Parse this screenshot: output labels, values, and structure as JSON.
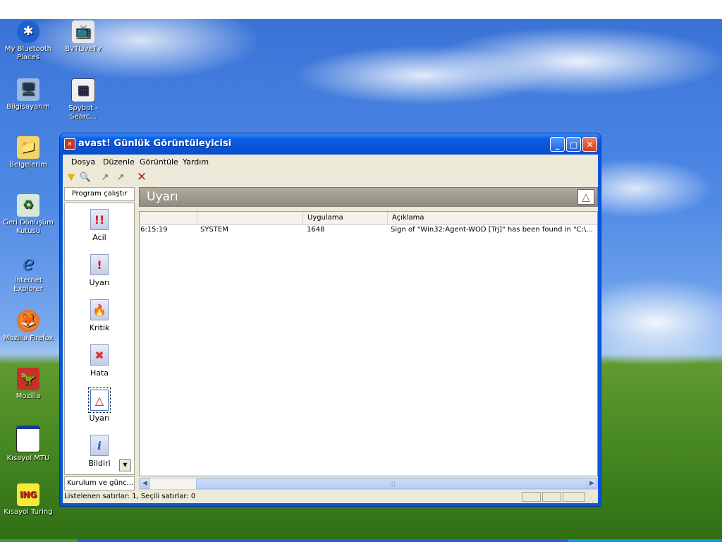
{
  "desktop": {
    "icons": [
      {
        "label": "My Bluetooth Places",
        "icon": "bluetooth-icon"
      },
      {
        "label": "BvTLiveTv",
        "icon": "tv-icon"
      },
      {
        "label": "Bilgisayarım",
        "icon": "computer-icon"
      },
      {
        "label": "Spybot - Searc...",
        "icon": "spybot-icon"
      },
      {
        "label": "Belgelerim",
        "icon": "folder-icon"
      },
      {
        "label": "Geri Dönüşüm Kutusu",
        "icon": "recycle-bin-icon"
      },
      {
        "label": "Internet Explorer",
        "icon": "ie-icon"
      },
      {
        "label": "Mozilla Firefox",
        "icon": "firefox-icon"
      },
      {
        "label": "Mozilla",
        "icon": "mozilla-icon"
      },
      {
        "label": "Kısayol MTU",
        "icon": "window-shortcut-icon"
      },
      {
        "label": "Kısayol Turing",
        "icon": "ing-icon"
      }
    ]
  },
  "window": {
    "title": "avast! Günlük Görüntüleyicisi",
    "menu": [
      "Dosya",
      "Düzenle",
      "Görüntüle",
      "Yardım"
    ],
    "left_pane": {
      "header": "Program çalıştır",
      "items": [
        {
          "label": "Acil",
          "icon": "emergency-icon"
        },
        {
          "label": "Uyarı",
          "icon": "exclamation-icon"
        },
        {
          "label": "Kritik",
          "icon": "fire-icon"
        },
        {
          "label": "Hata",
          "icon": "error-x-icon"
        },
        {
          "label": "Uyarı",
          "icon": "warning-triangle-icon",
          "selected": true
        },
        {
          "label": "Bildiri",
          "icon": "info-icon"
        }
      ],
      "footer": "Kurulum ve günc..."
    },
    "banner": {
      "title": "Uyarı"
    },
    "list": {
      "columns": [
        "",
        "",
        "Uygulama",
        "Açıklama"
      ],
      "rows": [
        {
          "time": "6:15:19",
          "user": "SYSTEM",
          "app": "1648",
          "desc": "Sign of \"Win32:Agent-WOD [Trj]\" has been found in \"C:\\..."
        }
      ]
    },
    "status": {
      "text": "Listelenen satırlar: 1, Seçili satırlar: 0"
    }
  },
  "colors": {
    "titlebar": "#0a5ee8",
    "client_bg": "#ece9d8",
    "banner": "#9e9b8f"
  }
}
